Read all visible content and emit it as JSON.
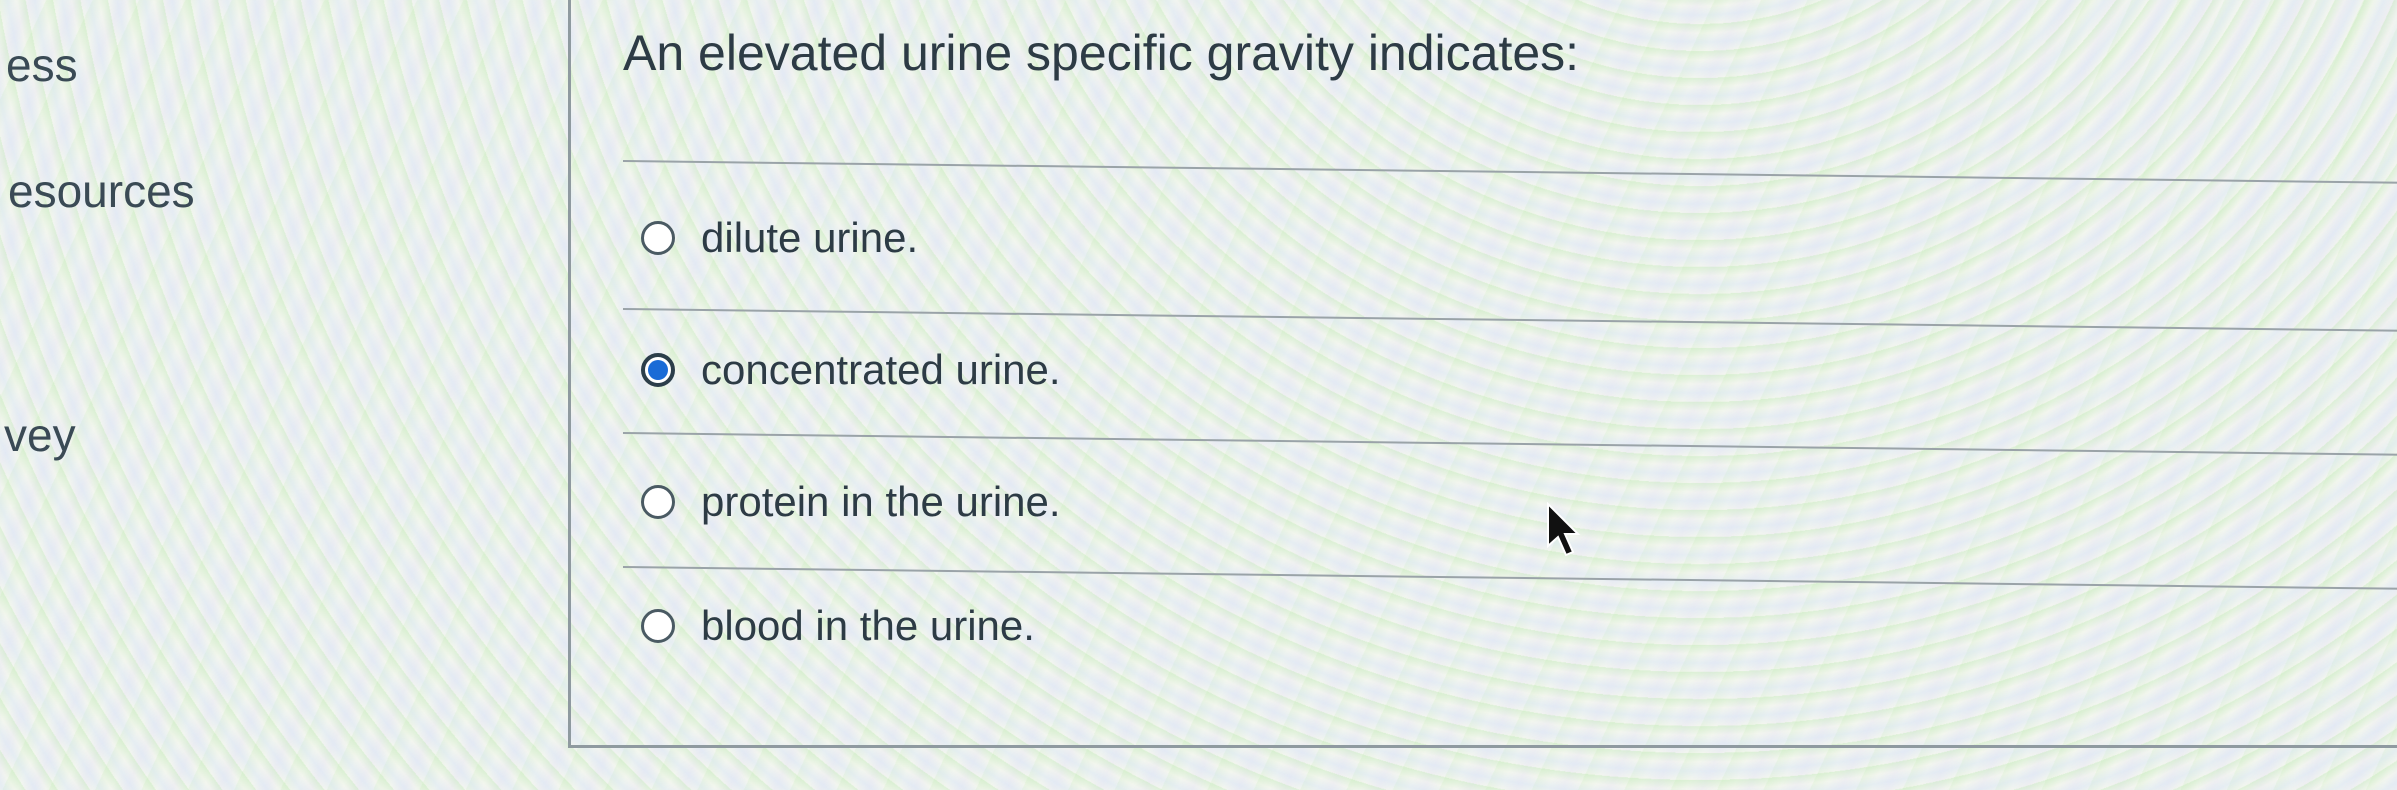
{
  "sidebar": {
    "items": [
      {
        "label": "ess"
      },
      {
        "label": "esources"
      },
      {
        "label": "vey"
      }
    ]
  },
  "question": {
    "text": "An elevated urine specific gravity indicates:",
    "options": [
      {
        "label": "dilute urine.",
        "selected": false
      },
      {
        "label": "concentrated urine.",
        "selected": true
      },
      {
        "label": "protein in the urine.",
        "selected": false
      },
      {
        "label": "blood in the urine.",
        "selected": false
      }
    ]
  },
  "colors": {
    "text": "#2d3b45",
    "radio_selected": "#1a6bd6",
    "divider": "#9aa3a8"
  },
  "icons": {
    "cursor": "mouse-pointer-icon"
  }
}
